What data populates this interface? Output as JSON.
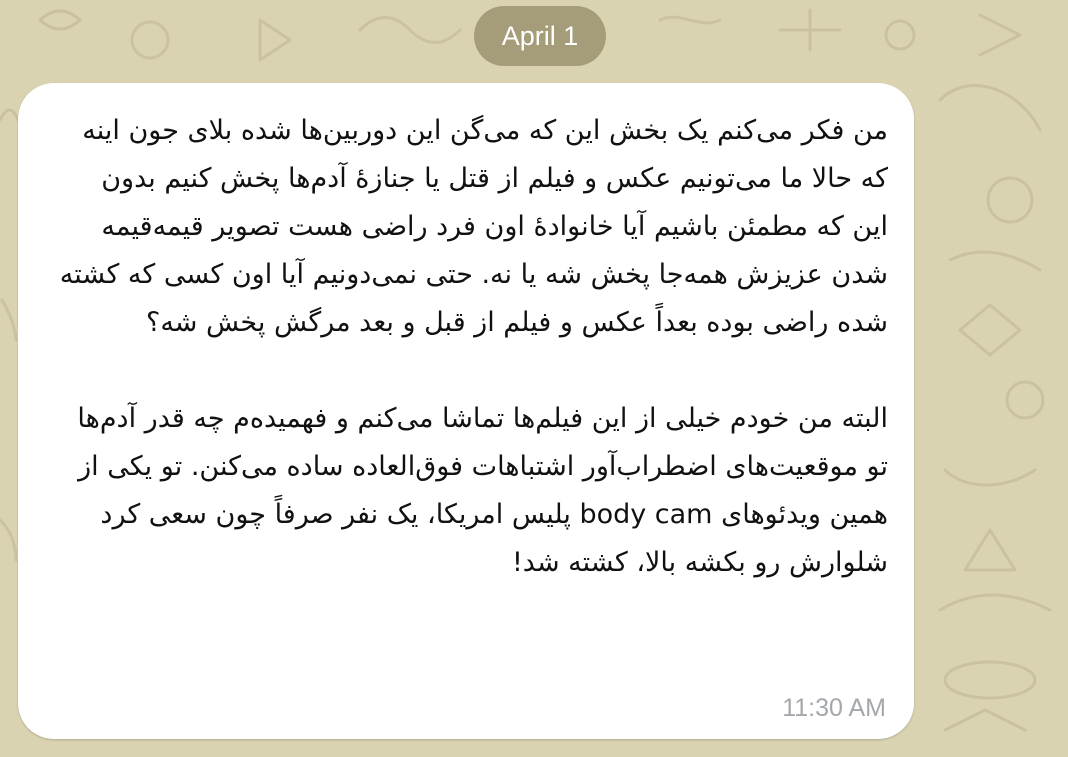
{
  "chat": {
    "date_label": "April 1",
    "message": {
      "text": "من فکر می‌کنم یک بخش این که می‌گن این دوربین‌ها شده بلای جون اینه که حالا ما می‌تونیم عکس و فیلم از قتل یا جنازهٔ آدم‌ها پخش کنیم بدون این که مطمئن باشیم آیا خانوادهٔ اون فرد راضی هست تصویر قیمه‌قیمه شدن عزیزش همه‌جا پخش شه یا نه. حتی نمی‌دونیم آیا اون کسی که کشته شده راضی بوده بعداً عکس و فیلم از قبل و بعد مرگش پخش شه؟\n\nالبته من خودم خیلی از این فیلم‌ها تماشا می‌کنم و فهمیده‌م چه قدر آدم‌ها تو موقعیت‌های اضطراب‌آور اشتباهات فوق‌العاده ساده می‌کنن. تو یکی از همین ویدئوهای body cam پلیس امریکا، یک نفر صرفاً چون سعی کرد شلوارش رو بکشه بالا، کشته شد!",
      "time": "11:30 AM"
    }
  },
  "colors": {
    "wallpaper": "#d9d3b2",
    "wallpaper_pattern": "#c7bf99",
    "bubble": "#ffffff",
    "date_pill": "#968e69",
    "timestamp": "#a4a8ac"
  }
}
